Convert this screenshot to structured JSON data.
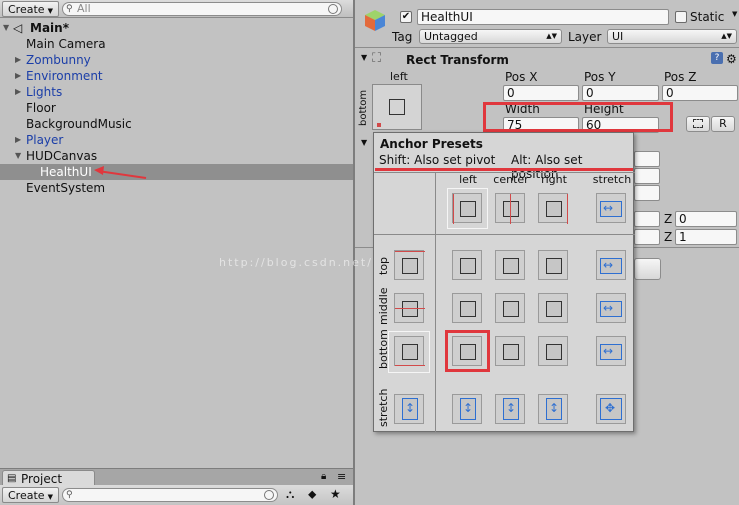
{
  "hierarchy": {
    "create_label": "Create",
    "search_placeholder": "All",
    "scene": "Main*",
    "items": [
      {
        "label": "Main Camera",
        "blue": false
      },
      {
        "label": "Zombunny",
        "blue": true
      },
      {
        "label": "Environment",
        "blue": true
      },
      {
        "label": "Lights",
        "blue": true
      },
      {
        "label": "Floor",
        "blue": false
      },
      {
        "label": "BackgroundMusic",
        "blue": false
      },
      {
        "label": "Player",
        "blue": true
      },
      {
        "label": "HUDCanvas",
        "blue": false
      },
      {
        "label": "HealthUI",
        "blue": false,
        "selected": true
      },
      {
        "label": "EventSystem",
        "blue": false
      }
    ]
  },
  "project": {
    "tab_label": "Project",
    "create_label": "Create"
  },
  "inspector": {
    "object_name": "HealthUI",
    "static_label": "Static",
    "tag_label": "Tag",
    "tag_value": "Untagged",
    "layer_label": "Layer",
    "layer_value": "UI",
    "component_title": "Rect Transform",
    "anchor_label": "left",
    "anchor_side_label": "bottom",
    "pos_x_label": "Pos X",
    "pos_y_label": "Pos Y",
    "pos_z_label": "Pos Z",
    "pos_x": "0",
    "pos_y": "0",
    "pos_z": "0",
    "width_label": "Width",
    "height_label": "Height",
    "width": "75",
    "height": "60",
    "r_button": "R",
    "z_label": "Z",
    "z_value_1": "0",
    "z_value_2": "1"
  },
  "presets": {
    "title": "Anchor Presets",
    "shift_hint": "Shift: Also set pivot",
    "alt_hint": "Alt: Also set position",
    "columns": [
      "left",
      "center",
      "right",
      "stretch"
    ],
    "rows": [
      "top",
      "middle",
      "bottom",
      "stretch"
    ],
    "selected": "bottom-left"
  },
  "watermark": "http://blog.csdn.net/",
  "colors": {
    "highlight_red": "#e0373d",
    "selection_gray": "#8f8f8f",
    "prefab_blue": "#1b3ea8"
  }
}
